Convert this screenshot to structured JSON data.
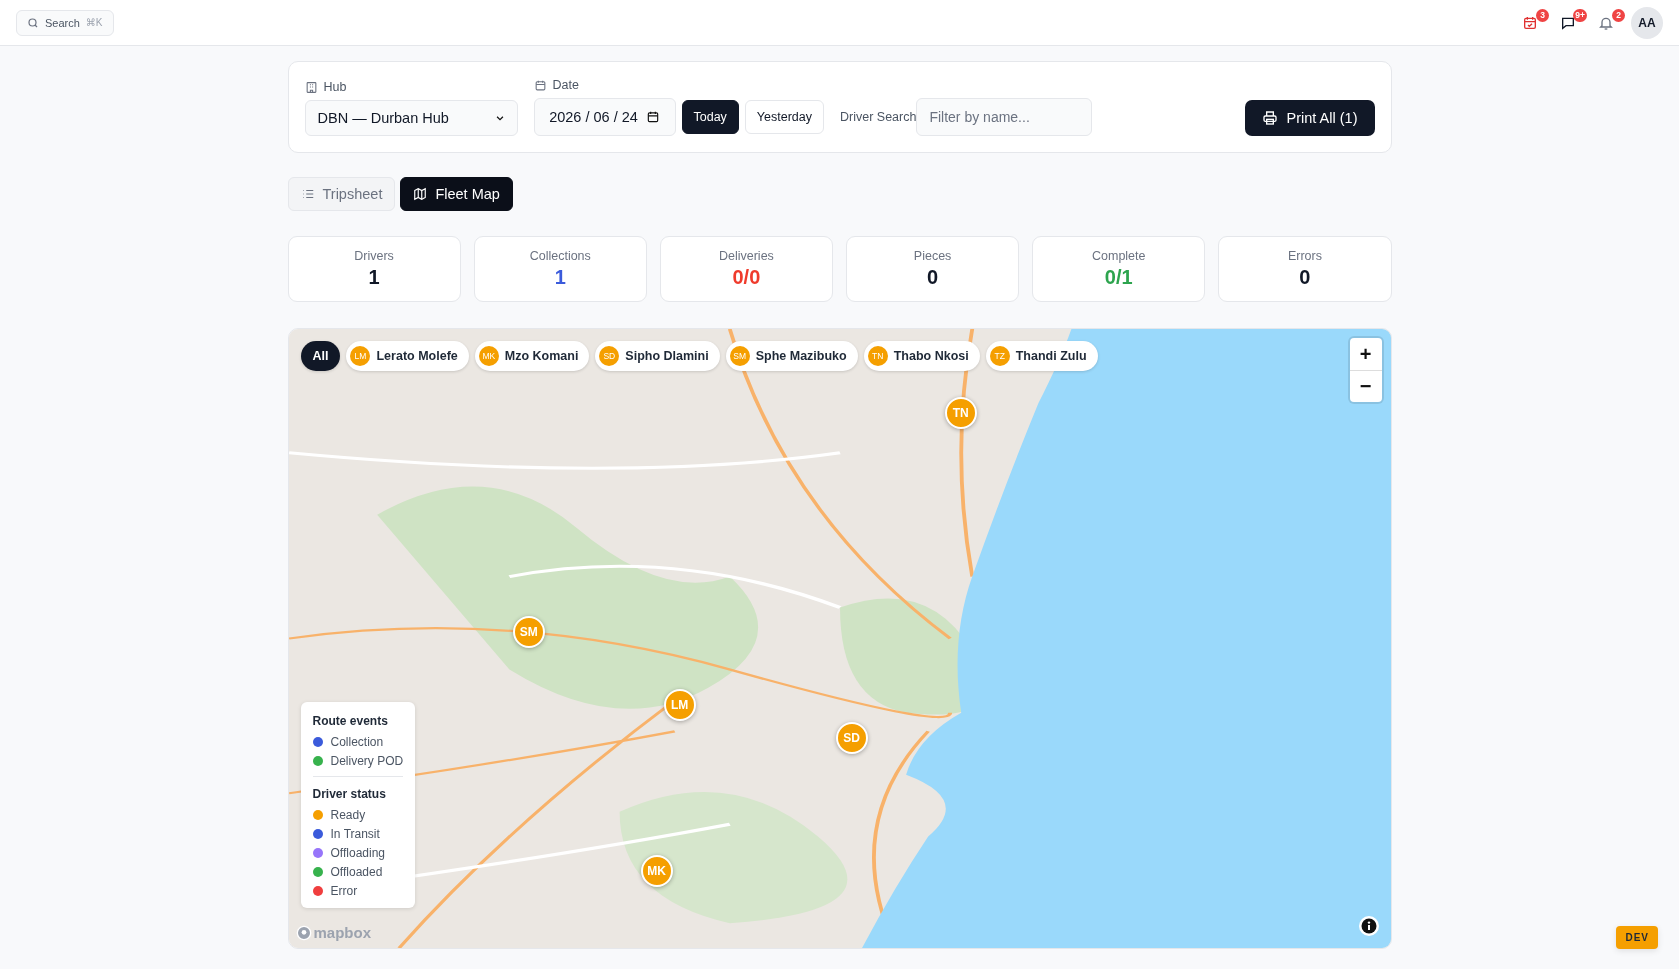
{
  "topbar": {
    "search": {
      "label": "Search",
      "shortcut": "⌘K"
    },
    "icons": [
      {
        "kind": "calendar",
        "badge": "3"
      },
      {
        "kind": "message",
        "badge": "9+"
      },
      {
        "kind": "bell",
        "badge": "2"
      }
    ],
    "avatar": "AA"
  },
  "filters": {
    "hub": {
      "label": "Hub",
      "value": "DBN — Durban Hub"
    },
    "date": {
      "label": "Date",
      "value": "2026 / 06 / 24"
    },
    "quick": [
      {
        "label": "Today",
        "selected": true
      },
      {
        "label": "Yesterday",
        "selected": false
      }
    ],
    "driver_search": {
      "label": "Driver Search",
      "placeholder": "Filter by name..."
    },
    "print": "Print All (1)"
  },
  "views": [
    {
      "label": "Tripsheet",
      "kind": "list",
      "selected": false
    },
    {
      "label": "Fleet Map",
      "kind": "map",
      "selected": true
    }
  ],
  "stats": [
    {
      "label": "Drivers",
      "value": "1",
      "color": "#111827"
    },
    {
      "label": "Collections",
      "value": "1",
      "color": "#3b5bdb"
    },
    {
      "label": "Deliveries",
      "value": "0/0",
      "color": "#ef3b2c"
    },
    {
      "label": "Pieces",
      "value": "0",
      "color": "#111827"
    },
    {
      "label": "Complete",
      "value": "0/1",
      "color": "#2da44e"
    },
    {
      "label": "Errors",
      "value": "0",
      "color": "#111827"
    }
  ],
  "map": {
    "chips": [
      {
        "label": "All",
        "selected": true
      },
      {
        "initials": "LM",
        "label": "Lerato Molefe",
        "selected": false
      },
      {
        "initials": "MK",
        "label": "Mzo Komani",
        "selected": false
      },
      {
        "initials": "SD",
        "label": "Sipho Dlamini",
        "selected": false
      },
      {
        "initials": "SM",
        "label": "Sphe Mazibuko",
        "selected": false
      },
      {
        "initials": "TN",
        "label": "Thabo Nkosi",
        "selected": false
      },
      {
        "initials": "TZ",
        "label": "Thandi Zulu",
        "selected": false
      }
    ],
    "markers": [
      {
        "initials": "TN",
        "color": "#f59f00"
      },
      {
        "initials": "SM",
        "color": "#f59f00"
      },
      {
        "initials": "LM",
        "color": "#f59f00"
      },
      {
        "initials": "SD",
        "color": "#f59f00"
      },
      {
        "initials": "MK",
        "color": "#f59f00"
      }
    ],
    "zoom": [
      "+",
      "−"
    ],
    "legend": [
      {
        "title": "Route events",
        "items": [
          {
            "label": "Collection",
            "color": "#3b5bdb"
          },
          {
            "label": "Delivery POD",
            "color": "#37b24d"
          }
        ]
      },
      {
        "title": "Driver status",
        "items": [
          {
            "label": "Ready",
            "color": "#f59f00"
          },
          {
            "label": "In Transit",
            "color": "#3b5bdb"
          },
          {
            "label": "Offloading",
            "color": "#9775fa"
          },
          {
            "label": "Offloaded",
            "color": "#37b24d"
          },
          {
            "label": "Error",
            "color": "#f03e3e"
          }
        ]
      }
    ],
    "attribution": "mapbox"
  },
  "env_badge": "DEV"
}
